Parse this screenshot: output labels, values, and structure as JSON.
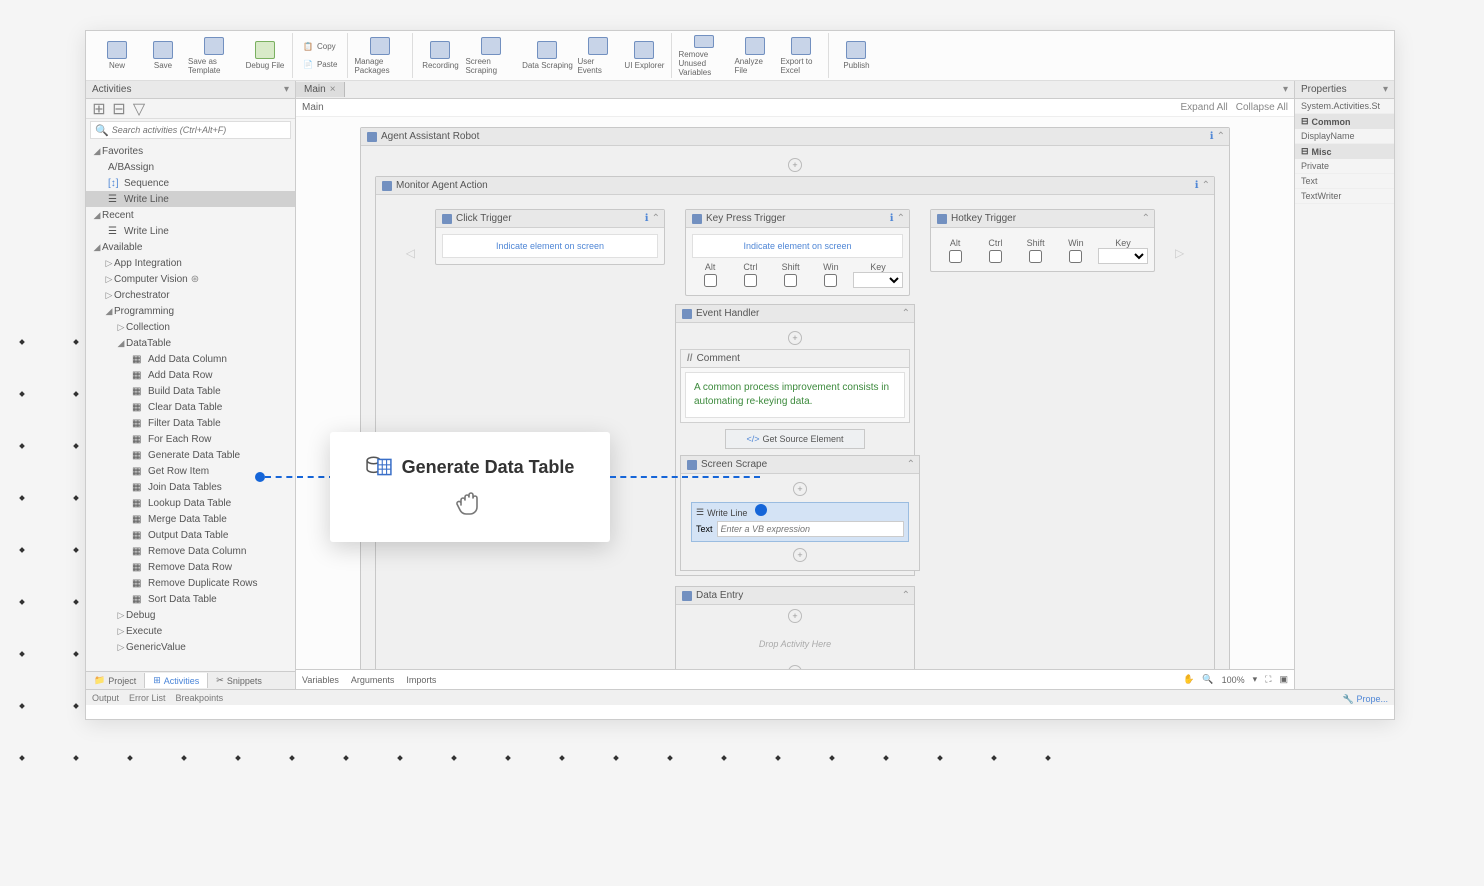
{
  "ribbon": {
    "new": "New",
    "save": "Save",
    "saveAs": "Save as Template",
    "debug": "Debug File",
    "copy": "Copy",
    "paste": "Paste",
    "manage": "Manage Packages",
    "recording": "Recording",
    "screenScraping": "Screen Scraping",
    "dataScraping": "Data Scraping",
    "userEvents": "User Events",
    "uiExplorer": "UI Explorer",
    "removeUnused": "Remove Unused Variables",
    "analyze": "Analyze File",
    "export": "Export to Excel",
    "publish": "Publish"
  },
  "activities": {
    "title": "Activities",
    "searchPlaceholder": "Search activities (Ctrl+Alt+F)",
    "sections": {
      "favorites": "Favorites",
      "recent": "Recent",
      "available": "Available"
    },
    "favs": [
      "Assign",
      "Sequence",
      "Write Line"
    ],
    "recentItems": [
      "Write Line"
    ],
    "available": {
      "appIntegration": "App Integration",
      "computerVision": "Computer Vision",
      "orchestrator": "Orchestrator",
      "programming": "Programming",
      "collection": "Collection",
      "datatable": "DataTable",
      "dtItems": [
        "Add Data Column",
        "Add Data Row",
        "Build Data Table",
        "Clear Data Table",
        "Filter Data Table",
        "For Each Row",
        "Generate Data Table",
        "Get Row Item",
        "Join Data Tables",
        "Lookup Data Table",
        "Merge Data Table",
        "Output Data Table",
        "Remove Data Column",
        "Remove Data Row",
        "Remove Duplicate Rows",
        "Sort Data Table"
      ],
      "debug": "Debug",
      "execute": "Execute",
      "genericValue": "GenericValue"
    },
    "tabs": {
      "project": "Project",
      "activities": "Activities",
      "snippets": "Snippets"
    }
  },
  "canvas": {
    "tab": "Main",
    "breadcrumb": "Main",
    "expandAll": "Expand All",
    "collapseAll": "Collapse All",
    "agentAssistant": "Agent Assistant Robot",
    "monitorAction": "Monitor Agent Action",
    "clickTrigger": "Click Trigger",
    "keyPressTrigger": "Key Press Trigger",
    "hotkeyTrigger": "Hotkey Trigger",
    "indicate": "Indicate element on screen",
    "keys": {
      "alt": "Alt",
      "ctrl": "Ctrl",
      "shift": "Shift",
      "win": "Win",
      "key": "Key"
    },
    "eventHandler": "Event Handler",
    "comment": "Comment",
    "commentText": "A common process improvement consists in automating re-keying data.",
    "getSource": "Get Source Element",
    "screenScrape": "Screen Scrape",
    "writeLine": "Write Line",
    "textLabel": "Text",
    "vbPlaceholder": "Enter a VB expression",
    "dataEntry": "Data Entry",
    "dropHint": "Drop Activity Here",
    "bottom": {
      "variables": "Variables",
      "arguments": "Arguments",
      "imports": "Imports",
      "zoom": "100%"
    }
  },
  "properties": {
    "title": "Properties",
    "type": "System.Activities.St",
    "common": "Common",
    "displayName": "DisplayName",
    "misc": "Misc",
    "private": "Private",
    "text": "Text",
    "textWriter": "TextWriter",
    "propeLink": "Prope..."
  },
  "status": {
    "output": "Output",
    "errorList": "Error List",
    "breakpoints": "Breakpoints"
  },
  "callout": "Generate Data Table"
}
